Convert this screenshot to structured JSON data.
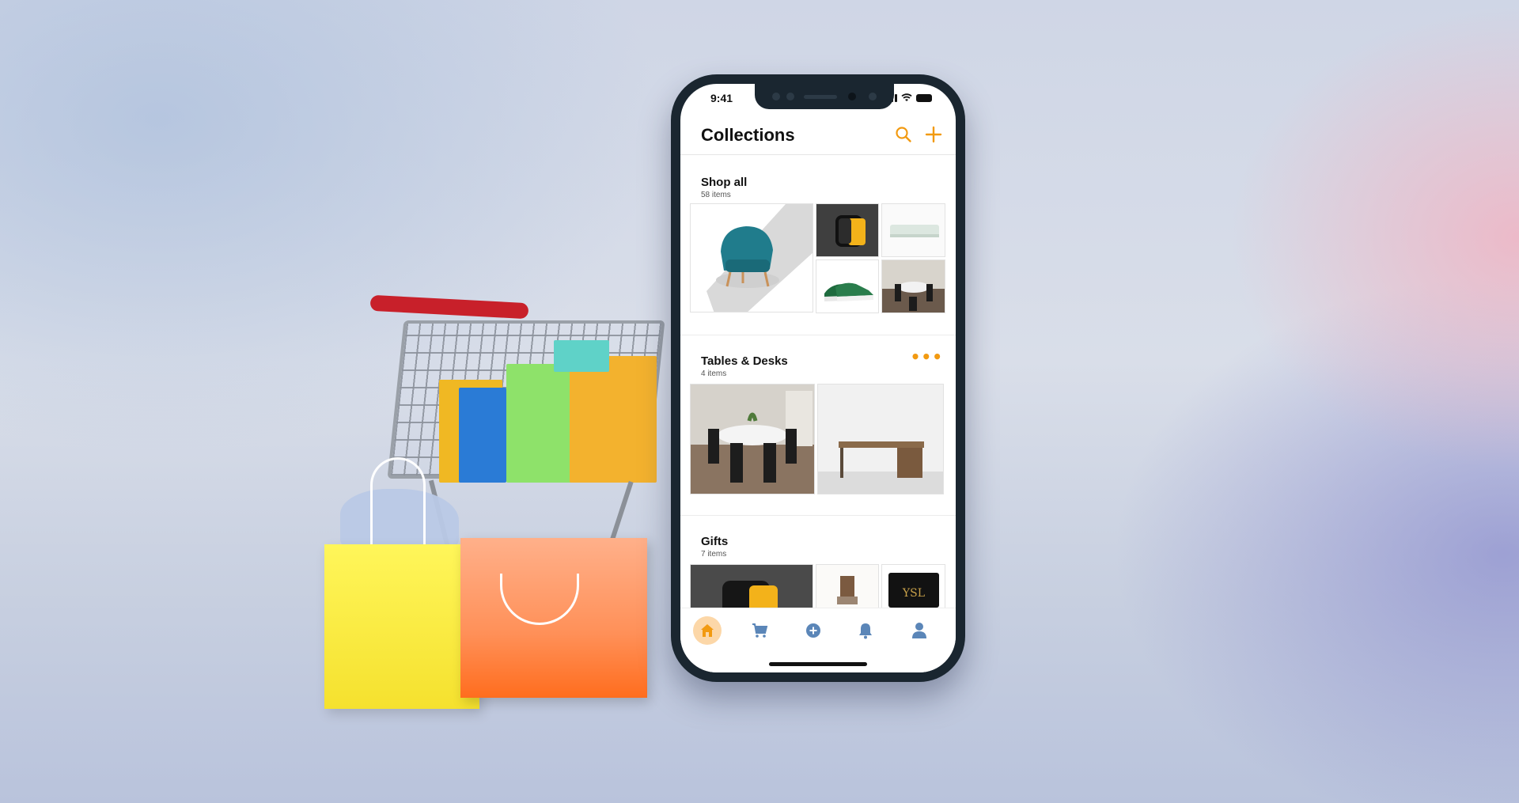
{
  "status_bar": {
    "time": "9:41"
  },
  "header": {
    "title": "Collections",
    "search_icon": "search-icon",
    "add_icon": "plus-icon",
    "accent_color": "#f29a11"
  },
  "collections": [
    {
      "title": "Shop all",
      "count": "58 items",
      "images": [
        "teal-armchair",
        "yellow-smartwatch",
        "white-shelf",
        "green-sneakers",
        "round-dining-table"
      ]
    },
    {
      "title": "Tables & Desks",
      "count": "4 items",
      "more_icon": "more-horizontal-icon",
      "images": [
        "round-dining-table",
        "wooden-desk"
      ]
    },
    {
      "title": "Gifts",
      "count": "7 items",
      "images": [
        "yellow-smartwatch",
        "desk-lamp",
        "black-card-wallet"
      ]
    }
  ],
  "tab_bar": {
    "items": [
      {
        "icon": "home-icon",
        "active": true
      },
      {
        "icon": "cart-icon",
        "active": false
      },
      {
        "icon": "plus-circle-icon",
        "active": false
      },
      {
        "icon": "bell-icon",
        "active": false
      },
      {
        "icon": "user-icon",
        "active": false
      }
    ],
    "active_color": "#f29a11",
    "inactive_color": "#5b86b8"
  }
}
